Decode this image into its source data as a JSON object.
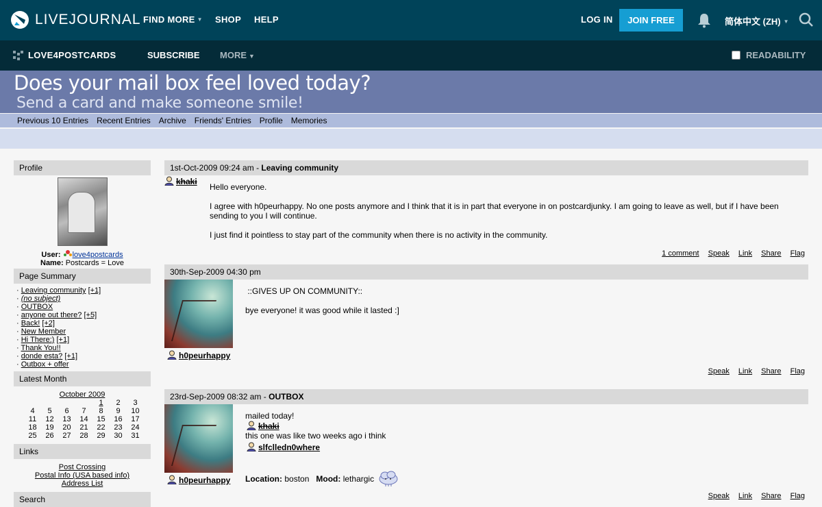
{
  "topbar": {
    "brand": "LIVEJOURNAL",
    "nav": [
      "FIND MORE",
      "SHOP",
      "HELP"
    ],
    "login": "LOG IN",
    "join": "JOIN FREE",
    "language": "简体中文 (ZH)"
  },
  "journalbar": {
    "name": "LOVE4POSTCARDS",
    "subscribe": "SUBSCRIBE",
    "more": "MORE",
    "readability": "READABILITY"
  },
  "banner": {
    "title": "Does your mail box feel loved today?",
    "subtitle": "Send a card and make someone smile!"
  },
  "navlinks": [
    "Previous 10 Entries",
    "Recent Entries",
    "Archive",
    "Friends' Entries",
    "Profile",
    "Memories"
  ],
  "sidebar": {
    "profile_head": "Profile",
    "user_label": "User:",
    "user_value": "love4postcards",
    "name_label": "Name:",
    "name_value": "Postcards = Love",
    "summary_head": "Page Summary",
    "summary": [
      {
        "title": "Leaving community",
        "extra": "[+1]"
      },
      {
        "title": "(no subject)",
        "extra": ""
      },
      {
        "title": "OUTBOX",
        "extra": ""
      },
      {
        "title": "anyone out there?",
        "extra": "[+5]"
      },
      {
        "title": "Back!",
        "extra": "[+2]"
      },
      {
        "title": "New Member",
        "extra": ""
      },
      {
        "title": "Hi There:)",
        "extra": "[+1]"
      },
      {
        "title": "Thank You!!",
        "extra": ""
      },
      {
        "title": "donde esta?",
        "extra": "[+1]"
      },
      {
        "title": "Outbox + offer",
        "extra": ""
      }
    ],
    "month_head": "Latest Month",
    "month": "October 2009",
    "calendar": [
      [
        "",
        "",
        "",
        "",
        "1",
        "2",
        "3"
      ],
      [
        "4",
        "5",
        "6",
        "7",
        "8",
        "9",
        "10"
      ],
      [
        "11",
        "12",
        "13",
        "14",
        "15",
        "16",
        "17"
      ],
      [
        "18",
        "19",
        "20",
        "21",
        "22",
        "23",
        "24"
      ],
      [
        "25",
        "26",
        "27",
        "28",
        "29",
        "30",
        "31"
      ]
    ],
    "links_head": "Links",
    "links": [
      "Post Crossing",
      "Postal Info (USA based info)",
      "Address List"
    ],
    "search_head": "Search"
  },
  "entries": [
    {
      "date": "1st-Oct-2009 09:24 am",
      "title": "Leaving community",
      "poster": "khaki",
      "paragraphs": [
        "Hello everyone.",
        "I agree with h0peurhappy. No one posts anymore and I think that it is in part that everyone in on postcardjunky. I am going to leave as well, but if I have been sending to you I will continue.",
        "I just find it pointless to stay part of the community when there is no activity in the community."
      ],
      "actions": [
        "1 comment",
        "Speak",
        "Link",
        "Share",
        "Flag"
      ]
    },
    {
      "date": "30th-Sep-2009 04:30 pm",
      "title": "",
      "poster": "h0peurhappy",
      "paragraphs": [
        " ::GIVES UP ON COMMUNITY::",
        "bye everyone! it was good while it lasted :]"
      ],
      "actions": [
        "Speak",
        "Link",
        "Share",
        "Flag"
      ]
    },
    {
      "date": "23rd-Sep-2009 08:32 am",
      "title": "OUTBOX",
      "poster": "h0peurhappy",
      "line1": "mailed today!",
      "user1": "khaki",
      "line2": "this one was like two weeks ago i think",
      "user2": "slfclledn0where",
      "location_label": "Location:",
      "location": "boston",
      "mood_label": "Mood:",
      "mood": "lethargic",
      "actions": [
        "Speak",
        "Link",
        "Share",
        "Flag"
      ]
    }
  ]
}
